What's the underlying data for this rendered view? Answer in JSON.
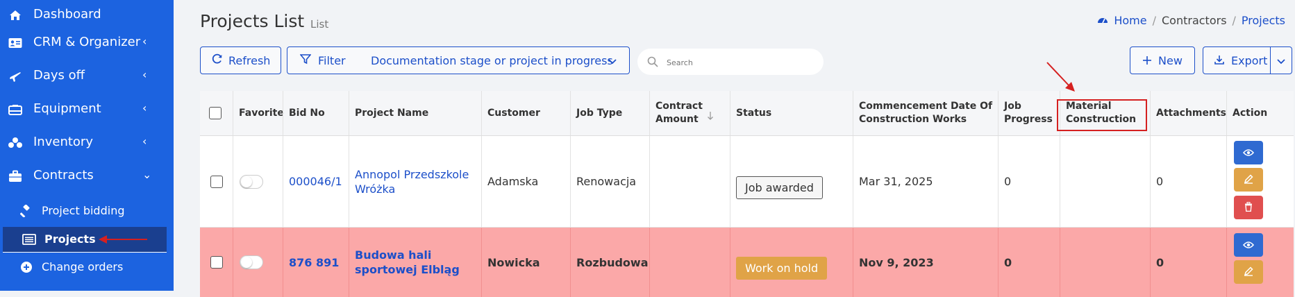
{
  "sidebar": {
    "items": [
      {
        "label": "Dashboard",
        "icon": "home-icon"
      },
      {
        "label": "CRM & Organizer",
        "icon": "contact-card-icon",
        "chevron": "‹"
      },
      {
        "label": "Days off",
        "icon": "plane-icon",
        "chevron": "‹"
      },
      {
        "label": "Equipment",
        "icon": "equipment-icon",
        "chevron": "‹"
      },
      {
        "label": "Inventory",
        "icon": "boxes-icon",
        "chevron": "‹"
      },
      {
        "label": "Contracts",
        "icon": "briefcase-icon",
        "chevron": "⌄"
      }
    ],
    "sub_items": [
      {
        "label": "Project bidding",
        "icon": "gavel-icon"
      },
      {
        "label": "Projects",
        "icon": "list-icon",
        "active": true
      },
      {
        "label": "Change orders",
        "icon": "plus-circle-icon"
      }
    ]
  },
  "header": {
    "title": "Projects List",
    "subtitle": "List",
    "breadcrumb": [
      "Home",
      "Contractors",
      "Projects"
    ]
  },
  "toolbar": {
    "refresh_label": "Refresh",
    "filter_label": "Filter",
    "filter_value": "Documentation stage or project in progress",
    "search_placeholder": "Search",
    "new_label": "New",
    "export_label": "Export"
  },
  "table": {
    "columns": [
      "",
      "Favorite",
      "Bid No",
      "Project Name",
      "Customer",
      "Job Type",
      "Contract Amount",
      "Status",
      "Commencement Date Of Construction Works",
      "Job Progress",
      "Material Construction",
      "Attachments",
      "Action"
    ],
    "rows": [
      {
        "bid_no": "000046/1",
        "project_name": "Annopol Przedszkole Wróżka",
        "customer": "Adamska",
        "job_type": "Renowacja",
        "contract_amount": "",
        "status": "Job awarded",
        "commencement_date": "Mar 31, 2025",
        "job_progress": "0",
        "material_construction": "",
        "attachments": "0"
      },
      {
        "bid_no": "876 891",
        "project_name": "Budowa hali sportowej Elbląg",
        "customer": "Nowicka",
        "job_type": "Rozbudowa",
        "contract_amount": "",
        "status": "Work on hold",
        "commencement_date": "Nov 9, 2023",
        "job_progress": "0",
        "material_construction": "",
        "attachments": "0"
      }
    ]
  },
  "colors": {
    "sidebar": "#1c63e0",
    "sidebar_active": "#1a3f8f",
    "accent": "#1c4fc9",
    "row_hold": "#fba8a8",
    "view_button": "#2f6ad1",
    "edit_button": "#e0a347",
    "delete_button": "#e04f4f",
    "annotation": "#d52020"
  }
}
